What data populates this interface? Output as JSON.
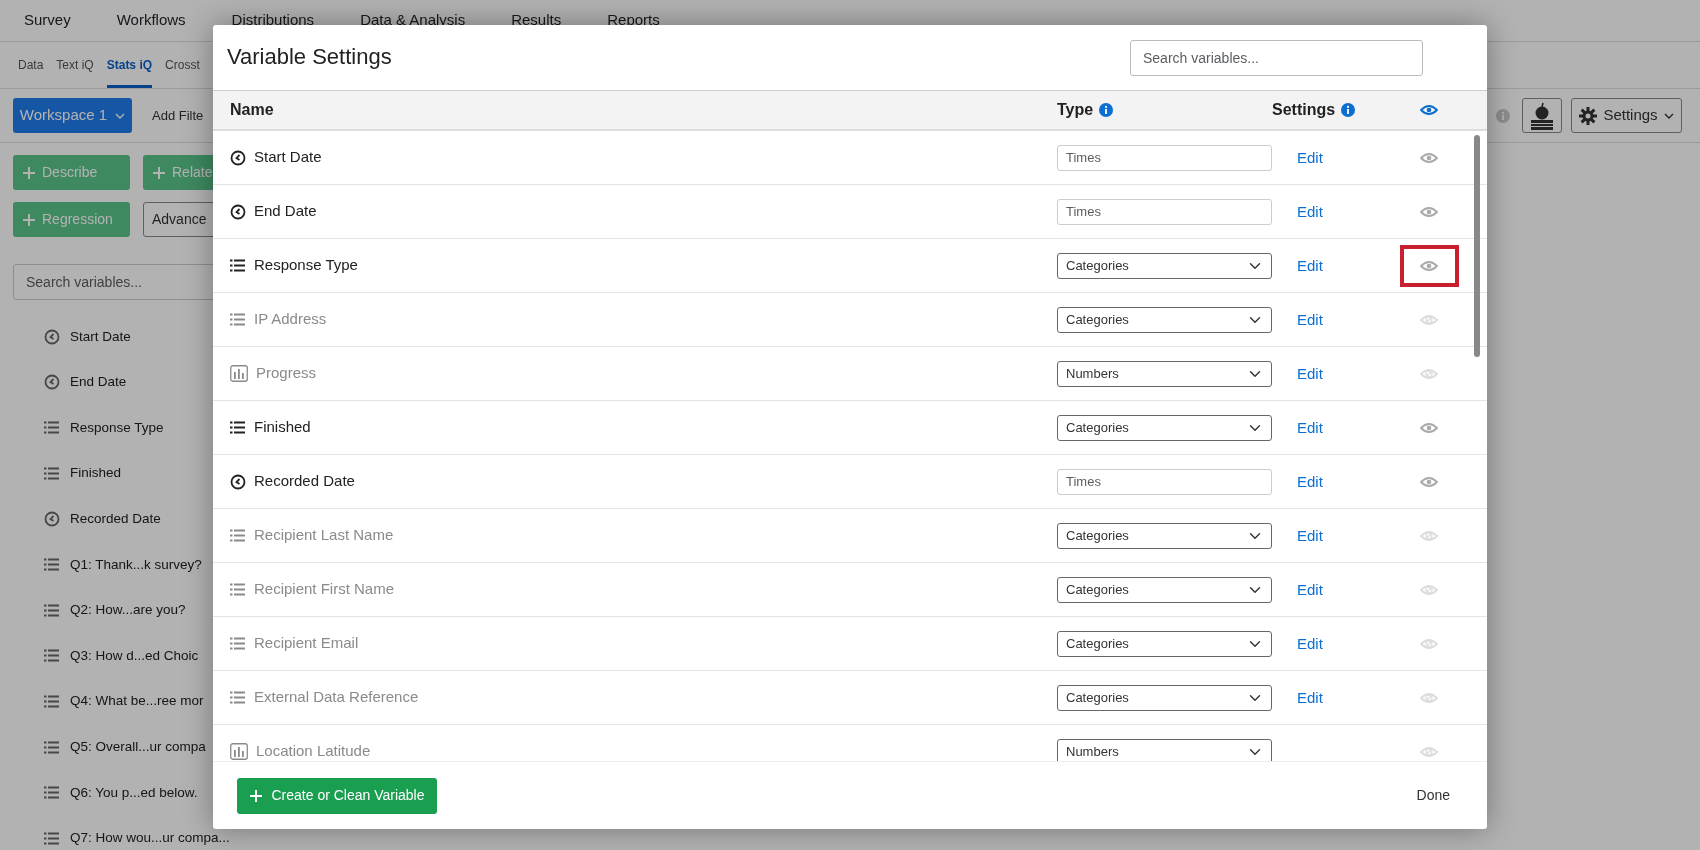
{
  "top_nav": [
    "Survey",
    "Workflows",
    "Distributions",
    "Data & Analysis",
    "Results",
    "Reports"
  ],
  "sub_nav": [
    {
      "label": "Data",
      "selected": false
    },
    {
      "label": "Text iQ",
      "selected": false
    },
    {
      "label": "Stats iQ",
      "selected": true
    },
    {
      "label": "Crosst",
      "selected": false
    }
  ],
  "toolbar": {
    "workspace": "Workspace 1",
    "add_filter": "Add Filte",
    "settings": "Settings"
  },
  "analysis_buttons": [
    {
      "label": "Describe",
      "kind": "primary"
    },
    {
      "label": "Relate",
      "kind": "primary"
    },
    {
      "label": "Regression",
      "kind": "primary"
    },
    {
      "label": "Advance",
      "kind": "outline"
    }
  ],
  "sidebar": {
    "search_placeholder": "Search variables...",
    "items": [
      {
        "label": "Start Date",
        "kind": "time"
      },
      {
        "label": "End Date",
        "kind": "time"
      },
      {
        "label": "Response Type",
        "kind": "list"
      },
      {
        "label": "Finished",
        "kind": "list"
      },
      {
        "label": "Recorded Date",
        "kind": "time"
      },
      {
        "label": "Q1: Thank...k survey?",
        "kind": "list"
      },
      {
        "label": "Q2: How...are you?",
        "kind": "list"
      },
      {
        "label": "Q3: How d...ed Choic",
        "kind": "list"
      },
      {
        "label": "Q4: What be...ree mor",
        "kind": "list"
      },
      {
        "label": "Q5: Overall...ur compa",
        "kind": "list"
      },
      {
        "label": "Q6: You p...ed below.",
        "kind": "list"
      },
      {
        "label": "Q7: How wou...ur compa...",
        "kind": "list"
      }
    ]
  },
  "modal": {
    "title": "Variable Settings",
    "search_placeholder": "Search variables...",
    "columns": [
      {
        "label": "Name",
        "info": false
      },
      {
        "label": "Type",
        "info": true
      },
      {
        "label": "Settings",
        "info": true
      }
    ],
    "rows": [
      {
        "name": "Start Date",
        "kind": "time",
        "visible": true,
        "type_field": {
          "kind": "input",
          "placeholder": "Times"
        },
        "edit": "Edit",
        "highlighted": false
      },
      {
        "name": "End Date",
        "kind": "time",
        "visible": true,
        "type_field": {
          "kind": "input",
          "placeholder": "Times"
        },
        "edit": "Edit",
        "highlighted": false
      },
      {
        "name": "Response Type",
        "kind": "list",
        "visible": true,
        "type_field": {
          "kind": "select",
          "value": "Categories"
        },
        "edit": "Edit",
        "highlighted": true
      },
      {
        "name": "IP Address",
        "kind": "list",
        "visible": false,
        "type_field": {
          "kind": "select",
          "value": "Categories"
        },
        "edit": "Edit",
        "highlighted": false
      },
      {
        "name": "Progress",
        "kind": "bars",
        "visible": false,
        "type_field": {
          "kind": "select",
          "value": "Numbers"
        },
        "edit": "Edit",
        "highlighted": false
      },
      {
        "name": "Finished",
        "kind": "list",
        "visible": true,
        "type_field": {
          "kind": "select",
          "value": "Categories"
        },
        "edit": "Edit",
        "highlighted": false
      },
      {
        "name": "Recorded Date",
        "kind": "time",
        "visible": true,
        "type_field": {
          "kind": "input",
          "placeholder": "Times"
        },
        "edit": "Edit",
        "highlighted": false
      },
      {
        "name": "Recipient Last Name",
        "kind": "list",
        "visible": false,
        "type_field": {
          "kind": "select",
          "value": "Categories"
        },
        "edit": "Edit",
        "highlighted": false
      },
      {
        "name": "Recipient First Name",
        "kind": "list",
        "visible": false,
        "type_field": {
          "kind": "select",
          "value": "Categories"
        },
        "edit": "Edit",
        "highlighted": false
      },
      {
        "name": "Recipient Email",
        "kind": "list",
        "visible": false,
        "type_field": {
          "kind": "select",
          "value": "Categories"
        },
        "edit": "Edit",
        "highlighted": false
      },
      {
        "name": "External Data Reference",
        "kind": "list",
        "visible": false,
        "type_field": {
          "kind": "select",
          "value": "Categories"
        },
        "edit": "Edit",
        "highlighted": false
      },
      {
        "name": "Location Latitude",
        "kind": "bars",
        "visible": false,
        "type_field": {
          "kind": "select",
          "value": "Numbers"
        },
        "highlighted": false
      }
    ],
    "create_button": "Create or Clean Variable",
    "done": "Done"
  }
}
